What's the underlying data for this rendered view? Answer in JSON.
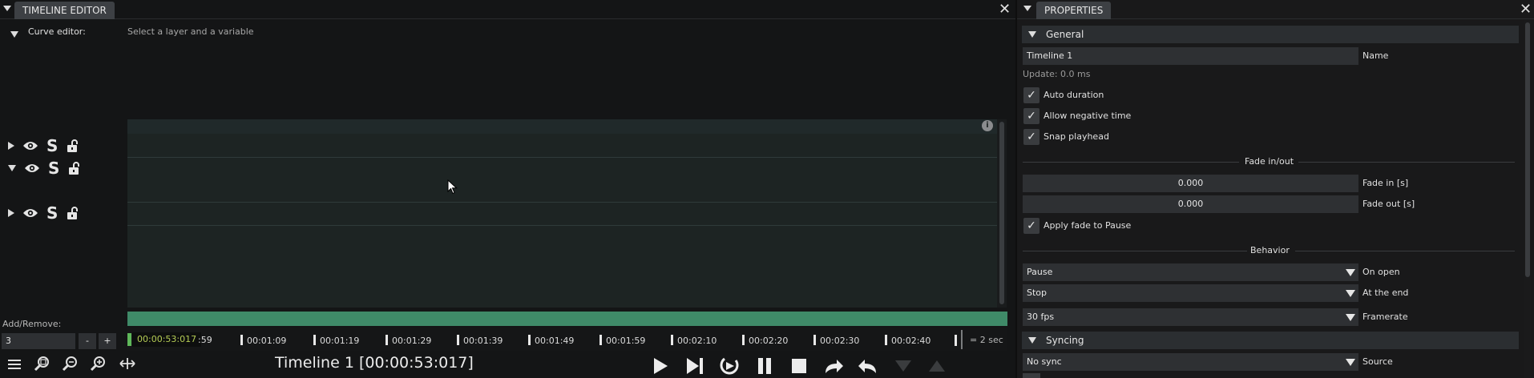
{
  "timeline_panel": {
    "title": "TIMELINE EDITOR",
    "curve_editor_label": "Curve editor:",
    "curve_editor_hint": "Select a layer and a variable",
    "add_remove_label": "Add/Remove:",
    "add_remove_value": "3",
    "minus_label": "-",
    "plus_label": "+",
    "playhead_time": "00:00:53:017",
    "ruler_ticks": [
      ":59",
      "00:01:09",
      "00:01:19",
      "00:01:29",
      "00:01:39",
      "00:01:49",
      "00:01:59",
      "00:02:10",
      "00:02:20",
      "00:02:30",
      "00:02:40"
    ],
    "scale_label": "= 2 sec",
    "timeline_status": "Timeline 1 [00:00:53:017]",
    "layers": [
      {
        "expanded": false
      },
      {
        "expanded": true
      },
      {
        "expanded": false
      }
    ],
    "accent_color": "#3f8a68"
  },
  "properties_panel": {
    "title": "PROPERTIES",
    "general_section": "General",
    "name_value": "Timeline 1",
    "name_label": "Name",
    "update_text": "Update: 0.0 ms",
    "auto_duration": "Auto duration",
    "allow_negative": "Allow negative time",
    "snap_playhead": "Snap playhead",
    "fade_header": "Fade in/out",
    "fade_in_value": "0.000",
    "fade_in_label": "Fade in [s]",
    "fade_out_value": "0.000",
    "fade_out_label": "Fade out [s]",
    "apply_fade": "Apply fade to Pause",
    "behavior_header": "Behavior",
    "on_open_value": "Pause",
    "on_open_label": "On open",
    "at_end_value": "Stop",
    "at_end_label": "At the end",
    "framerate_value": "30 fps",
    "framerate_label": "Framerate",
    "syncing_section": "Syncing",
    "source_value": "No sync",
    "source_label": "Source"
  }
}
